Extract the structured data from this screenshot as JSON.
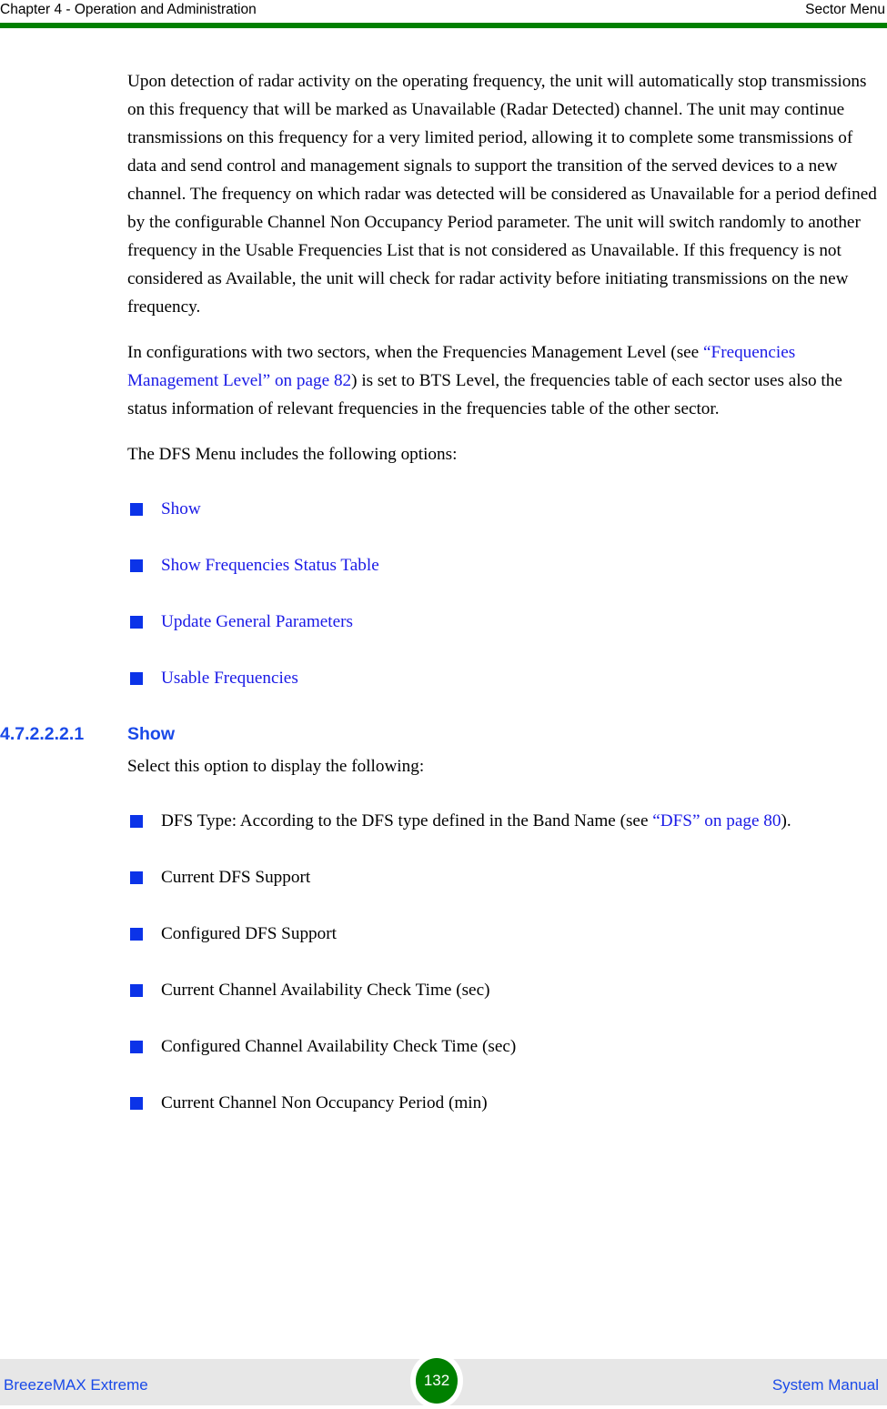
{
  "header": {
    "left": "Chapter 4 - Operation and Administration",
    "right": "Sector Menu",
    "rule_color": "#008000"
  },
  "body": {
    "paragraph_1": "Upon detection of radar activity on the operating frequency, the unit will automatically stop transmissions on this frequency that will be marked as Unavailable (Radar Detected) channel. The unit may continue transmissions on this frequency for a very limited period, allowing it to complete some transmissions of data and send control and management signals to support the transition of the served devices to a new channel. The frequency on which radar was detected will be considered as Unavailable for a period defined by the configurable Channel Non Occupancy Period parameter. The unit will switch randomly to another frequency in the Usable Frequencies List that is not considered as Unavailable. If this frequency is not considered as Available, the unit will check for radar activity before initiating transmissions on the new frequency.",
    "paragraph_2": {
      "before_link": "In configurations with two sectors, when the Frequencies Management Level (see ",
      "link": "“Frequencies Management Level” on page 82",
      "after_link": ") is set to BTS Level, the frequencies table of each sector uses also the status information of relevant frequencies in the frequencies table of the other sector."
    },
    "paragraph_3": "The DFS Menu includes the following options:",
    "options_list": [
      {
        "label": "Show"
      },
      {
        "label": "Show Frequencies Status Table"
      },
      {
        "label": "Update General Parameters"
      },
      {
        "label": "Usable Frequencies"
      }
    ],
    "section": {
      "number": "4.7.2.2.2.1",
      "title": "Show",
      "intro": "Select this option to display the following:"
    },
    "show_items": [
      {
        "before_link": "DFS Type: According to the DFS type defined in the Band Name (see ",
        "link": "“DFS” on page 80",
        "after_link": ")."
      },
      {
        "label": "Current DFS Support"
      },
      {
        "label": "Configured DFS Support"
      },
      {
        "label": "Current Channel Availability Check Time (sec)"
      },
      {
        "label": "Configured Channel Availability Check Time (sec)"
      },
      {
        "label": "Current Channel Non Occupancy Period (min)"
      }
    ]
  },
  "footer": {
    "left": "BreezeMAX Extreme",
    "right": "System Manual",
    "page_number": "132",
    "badge_color": "#008000",
    "band_color": "#e7e7e7"
  },
  "colors": {
    "link_blue": "#1a1ae6",
    "heading_blue": "#1a4ae8",
    "bullet_blue": "#0b33e8",
    "green": "#008000"
  }
}
